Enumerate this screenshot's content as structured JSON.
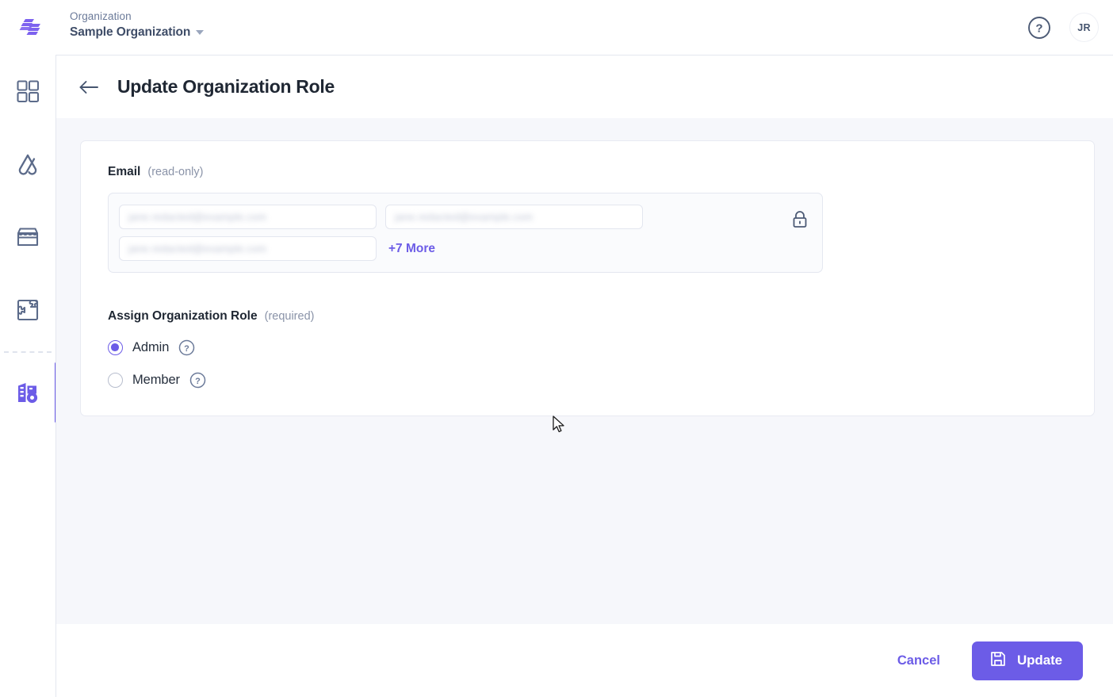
{
  "topbar": {
    "logo_icon": "stacked-layers-logo",
    "org_label": "Organization",
    "org_name": "Sample Organization",
    "caret_icon": "chevron-down-icon",
    "help_icon": "question-circle-icon",
    "avatar_initials": "JR"
  },
  "sidebar": {
    "items": [
      {
        "name": "dashboard",
        "icon": "grid-dashboard-icon",
        "active": false
      },
      {
        "name": "pipelines",
        "icon": "arch-flow-icon",
        "active": false
      },
      {
        "name": "marketplace",
        "icon": "storefront-icon",
        "active": false
      },
      {
        "name": "integrations",
        "icon": "puzzle-piece-icon",
        "active": false
      },
      {
        "name": "organization-settings",
        "icon": "building-gear-icon",
        "active": true
      }
    ]
  },
  "page": {
    "back_icon": "arrow-left-icon",
    "title": "Update Organization Role"
  },
  "email_field": {
    "label": "Email",
    "hint": "(read-only)",
    "lock_icon": "lock-closed-icon",
    "chips": [
      {
        "text": "jane.redacted@example.com",
        "redacted": true
      },
      {
        "text": "jane.redacted@example.com",
        "redacted": true
      },
      {
        "text": "jane.redacted@example.com",
        "redacted": true
      }
    ],
    "more_label": "+7 More"
  },
  "role_field": {
    "label": "Assign Organization Role",
    "hint": "(required)",
    "options": [
      {
        "label": "Admin",
        "selected": true,
        "help_icon": "question-circle-icon"
      },
      {
        "label": "Member",
        "selected": false,
        "help_icon": "question-circle-icon"
      }
    ]
  },
  "footer": {
    "cancel_label": "Cancel",
    "update_label": "Update",
    "update_icon": "save-floppy-icon"
  },
  "colors": {
    "accent": "#6c5ce7",
    "content_bg": "#f6f7fb",
    "card_bg": "#ffffff",
    "border": "#e4e7ef",
    "text_dark": "#1f2733",
    "text_muted": "#8a93a8",
    "sidebar_icon": "#5c6b8a"
  }
}
